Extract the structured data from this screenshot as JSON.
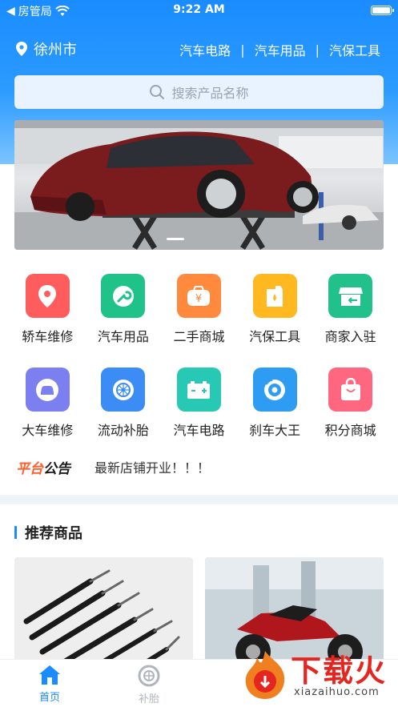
{
  "status_bar": {
    "carrier": "房管局",
    "time": "9:22 AM"
  },
  "location": {
    "city": "徐州市"
  },
  "quick_links": [
    "汽车电路",
    "汽车用品",
    "汽保工具"
  ],
  "search": {
    "placeholder": "搜索产品名称"
  },
  "categories": [
    {
      "label": "轿车维修",
      "icon": "location-pin-icon",
      "color": "#ff5d5d"
    },
    {
      "label": "汽车用品",
      "icon": "wrench-icon",
      "color": "#1fc38a"
    },
    {
      "label": "二手商城",
      "icon": "yen-bag-icon",
      "color": "#ff8a3d"
    },
    {
      "label": "汽保工具",
      "icon": "oil-can-icon",
      "color": "#ffb81f"
    },
    {
      "label": "商家入驻",
      "icon": "store-icon",
      "color": "#22c08a"
    },
    {
      "label": "大车维修",
      "icon": "car-icon",
      "color": "#7b7ff0"
    },
    {
      "label": "流动补胎",
      "icon": "tire-icon",
      "color": "#3b8df5"
    },
    {
      "label": "汽车电路",
      "icon": "battery-icon",
      "color": "#27c9b4"
    },
    {
      "label": "刹车大王",
      "icon": "brake-disc-icon",
      "color": "#2f9cf4"
    },
    {
      "label": "积分商城",
      "icon": "shopping-bag-icon",
      "color": "#ff6680"
    }
  ],
  "notice": {
    "tag_part1": "平台",
    "tag_part2": "公告",
    "text": "最新店铺开业！！！"
  },
  "recommend": {
    "title": "推荐商品"
  },
  "tabbar": {
    "home": "首页",
    "tire": "补胎"
  },
  "watermark": {
    "brand": "下载火",
    "domain": "xiazaihuo.com"
  },
  "colors": {
    "primary": "#1a8cff",
    "accent": "#ff5d2a"
  }
}
